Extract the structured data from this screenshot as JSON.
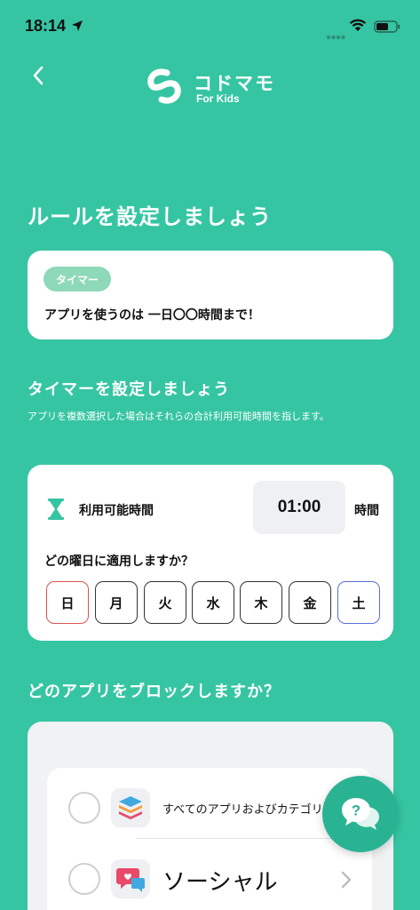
{
  "status": {
    "time": "18:14"
  },
  "header": {
    "app_name": "コドマモ",
    "app_sub": "For Kids"
  },
  "page": {
    "title": "ルールを設定しましょう"
  },
  "rule": {
    "badge": "タイマー",
    "text": "アプリを使うのは 一日〇〇時間まで！"
  },
  "timer": {
    "title": "タイマーを設定しましょう",
    "description": "アプリを複数選択した場合はそれらの合計利用可能時間を指します。",
    "available_label": "利用可能時間",
    "time_value": "01:00",
    "time_unit": "時間",
    "weekday_question": "どの曜日に適用しますか？",
    "days": [
      "日",
      "月",
      "火",
      "水",
      "木",
      "金",
      "土"
    ]
  },
  "block": {
    "title": "どのアプリをブロックしますか？",
    "items": [
      {
        "label": "すべてのアプリおよびカテゴリ",
        "icon": "stack-icon"
      },
      {
        "label": "ソーシャル",
        "icon": "social-chat-icon"
      }
    ]
  },
  "colors": {
    "background": "#36c5a2",
    "badge": "#8dd9b9",
    "sunday_border": "#d9534f",
    "saturday_border": "#5b6fd6",
    "fab": "#2ab393"
  }
}
